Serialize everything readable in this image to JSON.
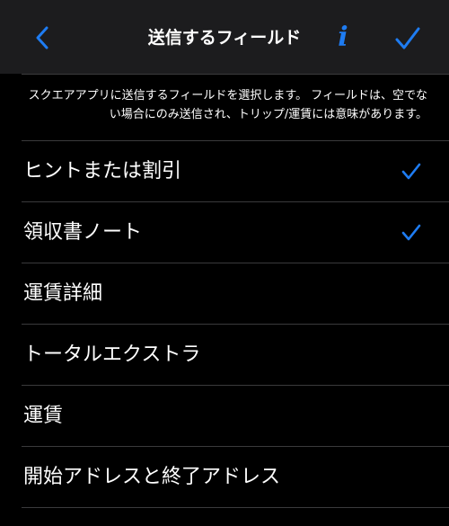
{
  "nav": {
    "title": "送信するフィールド",
    "info_label": "i",
    "accent": "#1e7cf2"
  },
  "description": "スクエアアプリに送信するフィールドを選択します。 フィールドは、空でない場合にのみ送信され、トリップ/運賃には意味があります。",
  "fields": [
    {
      "label": "ヒントまたは割引",
      "checked": true
    },
    {
      "label": "領収書ノート",
      "checked": true
    },
    {
      "label": "運賃詳細",
      "checked": false
    },
    {
      "label": "トータルエクストラ",
      "checked": false
    },
    {
      "label": "運賃",
      "checked": false
    },
    {
      "label": "開始アドレスと終了アドレス",
      "checked": false
    }
  ],
  "icons": {
    "back": "chevron-left-icon",
    "info": "info-icon",
    "done": "checkmark-icon",
    "row_check": "checkmark-icon"
  }
}
